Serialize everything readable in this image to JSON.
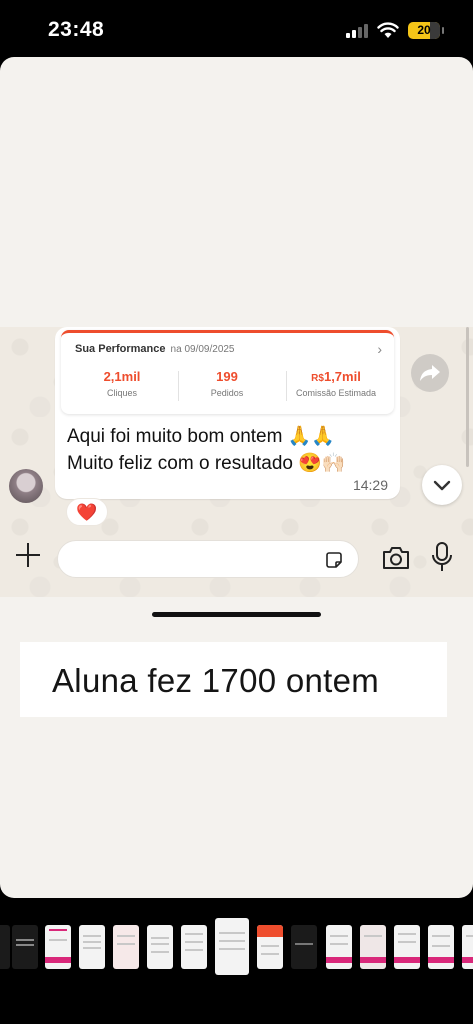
{
  "status_bar": {
    "time": "23:48",
    "battery": "20",
    "signal_icon": "cellular-signal-icon",
    "wifi_icon": "wifi-icon",
    "battery_icon": "battery-icon"
  },
  "chat": {
    "performance_card": {
      "title": "Sua Performance",
      "date": "na 09/09/2025",
      "stats": [
        {
          "value_prefix": "",
          "value": "2,1mil",
          "label": "Cliques"
        },
        {
          "value_prefix": "",
          "value": "199",
          "label": "Pedidos"
        },
        {
          "value_prefix": "R$",
          "value": "1,7mil",
          "label": "Comissão Estimada"
        }
      ],
      "accent_color": "#ee4d2d"
    },
    "message_lines": [
      "Aqui foi muito bom ontem 🙏🙏",
      "Muito feliz com o resultado 😍🙌🏻"
    ],
    "time": "14:29",
    "reaction": "❤️",
    "forward_icon": "forward-arrow-icon",
    "scroll_down_icon": "chevron-down-icon"
  },
  "input_bar": {
    "placeholder": "",
    "plus_icon": "plus-icon",
    "sticker_icon": "sticker-icon",
    "camera_icon": "camera-icon",
    "mic_icon": "microphone-icon"
  },
  "caption": "Aluna fez 1700 ontem"
}
